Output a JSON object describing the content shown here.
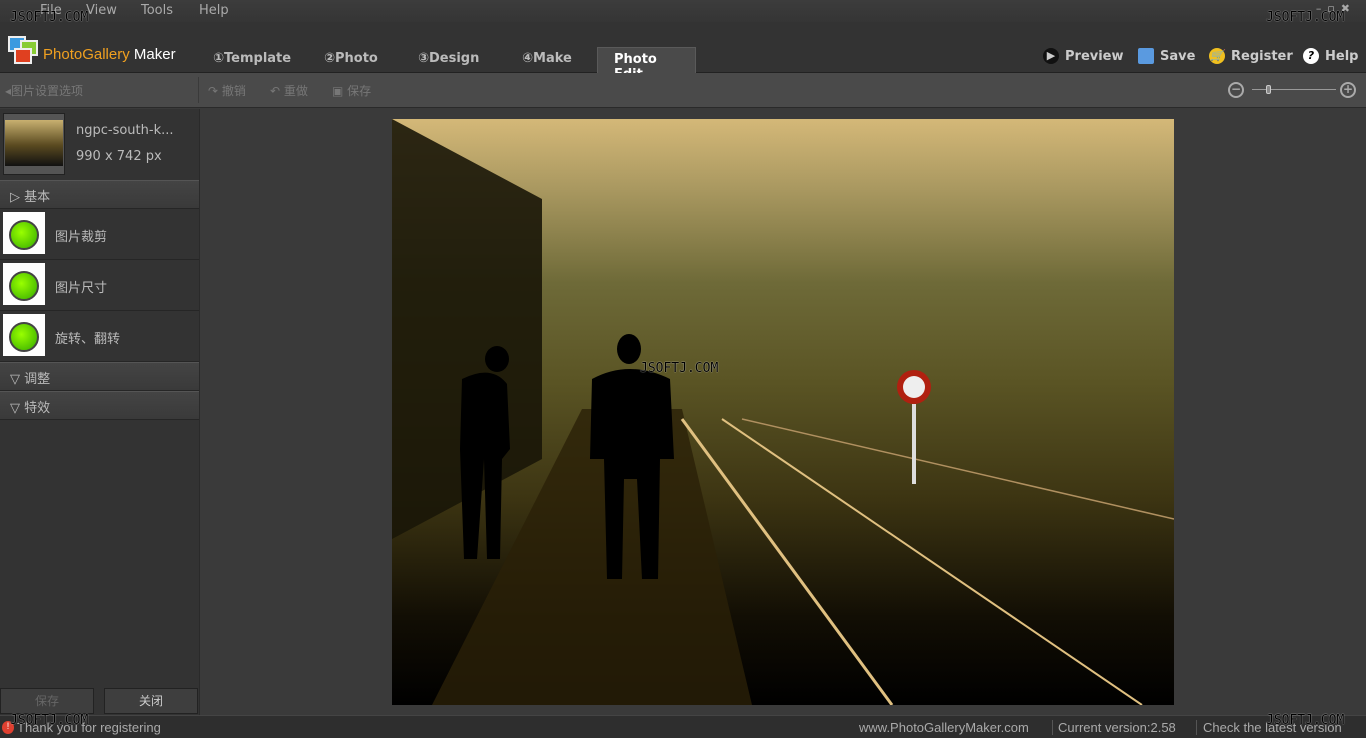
{
  "menu": [
    "File",
    "View",
    "Tools",
    "Help"
  ],
  "brand": {
    "name1": "PhotoGallery",
    "name2": "Maker"
  },
  "tabs": [
    {
      "label": "①Template"
    },
    {
      "label": "②Photo"
    },
    {
      "label": "③Design"
    },
    {
      "label": "④Make"
    },
    {
      "label": "Photo Edit",
      "active": true
    }
  ],
  "header_buttons": {
    "preview": "Preview",
    "save": "Save",
    "register": "Register",
    "help": "Help"
  },
  "toolbar": {
    "back": "图片设置选项",
    "undo": "撤销",
    "redo": "重做",
    "save": "保存",
    "zoom_level": 0.2
  },
  "file": {
    "name": "ngpc-south-k...",
    "size": "990 x 742 px"
  },
  "sections": {
    "basic": "基本",
    "adjust": "调整",
    "effects": "特效"
  },
  "tools": [
    "图片裁剪",
    "图片尺寸",
    "旋转、翻转"
  ],
  "sidebar_buttons": {
    "save": "保存",
    "close": "关闭"
  },
  "status": {
    "message": "Thank you for registering",
    "website": "www.PhotoGalleryMaker.com",
    "version": "Current version:2.58",
    "check": "Check the latest version"
  },
  "watermark": "JSOFTJ.COM"
}
